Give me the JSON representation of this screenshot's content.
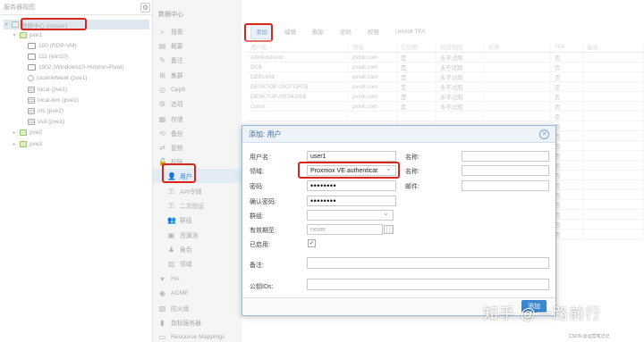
{
  "tree": {
    "view_select": "服务器视图",
    "nodes": [
      {
        "label": "数据中心 (cluster)",
        "icon": "datacenter-icon",
        "type": "dc",
        "level": 0
      },
      {
        "label": "pve1",
        "icon": "node-icon",
        "type": "node",
        "level": 1
      },
      {
        "label": "100 (RDP-VM)",
        "icon": "vm-icon",
        "type": "vm",
        "level": 2
      },
      {
        "label": "111 (win10)",
        "icon": "vm-icon",
        "type": "vm",
        "level": 2
      },
      {
        "label": "1902 (Windows10-Horizon-Pivot)",
        "icon": "vm-icon",
        "type": "vm",
        "level": 2
      },
      {
        "label": "localnetwork (pve1)",
        "icon": "sdn-icon",
        "type": "sdn",
        "level": 2
      },
      {
        "label": "local (pve1)",
        "icon": "storage-icon",
        "type": "store",
        "level": 2
      },
      {
        "label": "local-lvm (pve1)",
        "icon": "storage-icon",
        "type": "store",
        "level": 2
      },
      {
        "label": "nfs (pve1)",
        "icon": "storage-icon",
        "type": "store",
        "level": 2
      },
      {
        "label": "ssd (pve1)",
        "icon": "storage-icon",
        "type": "store",
        "level": 2
      },
      {
        "label": "pve2",
        "icon": "node-icon",
        "type": "node",
        "level": 1
      },
      {
        "label": "pve3",
        "icon": "node-icon",
        "type": "node",
        "level": 1
      }
    ]
  },
  "nav": {
    "title": "数据中心",
    "items": [
      {
        "label": "搜索",
        "icon": "⌕",
        "sub": false
      },
      {
        "label": "概要",
        "icon": "▤",
        "sub": false
      },
      {
        "label": "备注",
        "icon": "✎",
        "sub": false
      },
      {
        "label": "集群",
        "icon": "⊞",
        "sub": false
      },
      {
        "label": "Ceph",
        "icon": "◎",
        "sub": false
      },
      {
        "label": "选项",
        "icon": "⚙",
        "sub": false
      },
      {
        "label": "存储",
        "icon": "▦",
        "sub": false
      },
      {
        "label": "备份",
        "icon": "⟲",
        "sub": false
      },
      {
        "label": "复制",
        "icon": "⇄",
        "sub": false
      },
      {
        "label": "权限",
        "icon": "🔓",
        "sub": false
      },
      {
        "label": "用户",
        "icon": "👤",
        "sub": true,
        "active": true
      },
      {
        "label": "API令牌",
        "icon": "⚿",
        "sub": true
      },
      {
        "label": "二次验证",
        "icon": "⚿",
        "sub": true
      },
      {
        "label": "群组",
        "icon": "👥",
        "sub": true
      },
      {
        "label": "资源池",
        "icon": "▣",
        "sub": true
      },
      {
        "label": "角色",
        "icon": "♟",
        "sub": true
      },
      {
        "label": "领域",
        "icon": "▥",
        "sub": true
      },
      {
        "label": "HA",
        "icon": "♥",
        "sub": false
      },
      {
        "label": "ACME",
        "icon": "◉",
        "sub": false
      },
      {
        "label": "防火墙",
        "icon": "▧",
        "sub": false
      },
      {
        "label": "指标服务器",
        "icon": "▮",
        "sub": false
      },
      {
        "label": "Resource Mappings",
        "icon": "▭",
        "sub": false
      }
    ]
  },
  "toolbar": {
    "add": "添加",
    "edit": "编辑",
    "remove": "删除",
    "password": "密码",
    "permission": "权限",
    "unlock": "Unlock TFA"
  },
  "grid": {
    "headers": [
      "用户名 ↑",
      "领域",
      "已启用",
      "有效期限",
      "名称",
      "TFA",
      "备注"
    ],
    "rows": [
      [
        "Administrator",
        "pvxdi.com",
        "是",
        "永不过期",
        "",
        "否",
        ""
      ],
      [
        "DC$",
        "pvxdi.com",
        "是",
        "永不过期",
        "",
        "否",
        ""
      ],
      [
        "DEBIAN$",
        "pvxdi.com",
        "是",
        "永不过期",
        "",
        "否",
        ""
      ],
      [
        "DESKTOP-20OTOR7$",
        "pvxdi.com",
        "是",
        "永不过期",
        "",
        "否",
        ""
      ],
      [
        "DESKTOP-RES4J06$",
        "pvxdi.com",
        "是",
        "永不过期",
        "",
        "否",
        ""
      ],
      [
        "Guest",
        "pvxdi.com",
        "是",
        "永不过期",
        "",
        "否",
        ""
      ]
    ],
    "extra_tfa_rows": [
      "否",
      "否",
      "否",
      "否",
      "否",
      "否",
      "否",
      "否",
      "否",
      "否",
      "否",
      "否",
      "否"
    ]
  },
  "dialog": {
    "title": "添加: 用户",
    "username_label": "用户名:",
    "username_value": "user1",
    "realm_label": "领域:",
    "realm_value": "Proxmox VE authenticat",
    "password_label": "密码:",
    "password_value": "••••••••",
    "confirm_label": "确认密码:",
    "confirm_value": "••••••••",
    "group_label": "群组:",
    "group_value": "",
    "expire_label": "有效期至:",
    "expire_placeholder": "never",
    "enabled_label": "已启用:",
    "enabled_check": "✓",
    "firstname_label": "名称:",
    "lastname_label": "名称:",
    "email_label": "邮件:",
    "comment_label": "备注:",
    "keyids_label": "公钥IDs:",
    "add_button": "添加"
  },
  "watermark": {
    "text": "知乎 @一路前行",
    "small": "CSDN @运营笔记记"
  },
  "colors": {
    "highlight": "#d9251c",
    "accent": "#3a86d2"
  }
}
